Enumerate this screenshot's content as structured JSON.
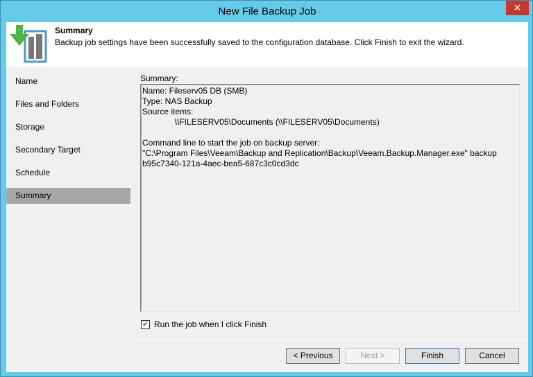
{
  "window": {
    "title": "New File Backup Job",
    "close": "✕"
  },
  "header": {
    "title": "Summary",
    "description": "Backup job settings have been successfully saved to the configuration database. Click Finish to exit the wizard."
  },
  "nav": {
    "items": [
      {
        "label": "Name"
      },
      {
        "label": "Files and Folders"
      },
      {
        "label": "Storage"
      },
      {
        "label": "Secondary Target"
      },
      {
        "label": "Schedule"
      },
      {
        "label": "Summary"
      }
    ],
    "selected": "Summary"
  },
  "summary": {
    "label": "Summary:",
    "text": "Name: Fileserv05 DB (SMB)\nType: NAS Backup\nSource items:\n              \\\\FILESERV05\\Documents (\\\\FILESERV05\\Documents)\n\nCommand line to start the job on backup server:\n\"C:\\Program Files\\Veeam\\Backup and Replication\\Backup\\Veeam.Backup.Manager.exe\" backup\nb95c7340-121a-4aec-bea5-687c3c0cd3dc"
  },
  "run_checkbox": {
    "label": "Run the job when I click Finish",
    "checked": true,
    "mark": "✓"
  },
  "buttons": {
    "previous": "< Previous",
    "next": "Next >",
    "finish": "Finish",
    "cancel": "Cancel"
  }
}
